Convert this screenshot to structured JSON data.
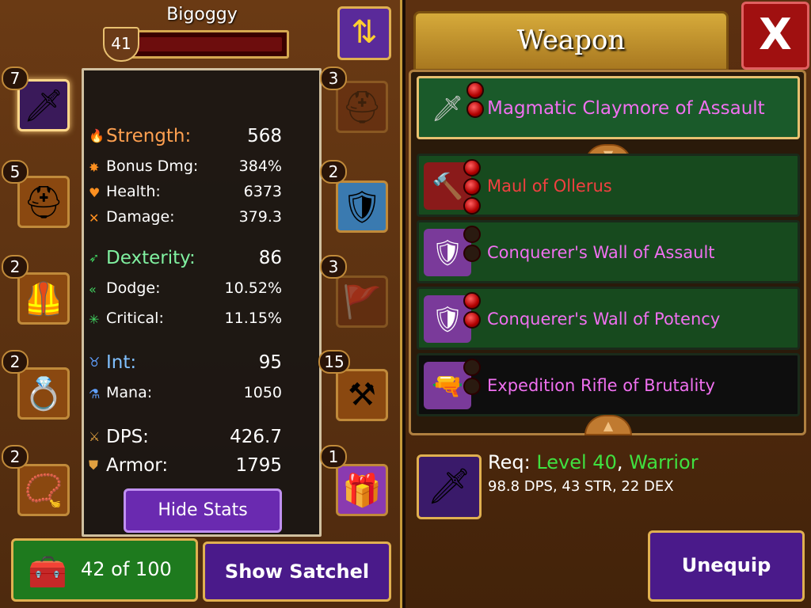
{
  "hero": {
    "name": "Bigoggy",
    "level": "41"
  },
  "left_slots": [
    {
      "count": "7",
      "icon": "dagger-icon"
    },
    {
      "count": "5",
      "icon": "helmet-icon"
    },
    {
      "count": "2",
      "icon": "chest-armor-icon"
    },
    {
      "count": "2",
      "icon": "ring-icon"
    },
    {
      "count": "2",
      "icon": "amulet-icon"
    }
  ],
  "right_slots": [
    {
      "count": "3",
      "icon": "helmet-icon"
    },
    {
      "count": "2",
      "icon": "shoulder-armor-icon"
    },
    {
      "count": "3",
      "icon": "banner-icon"
    },
    {
      "count": "15",
      "icon": "anvil-icon"
    },
    {
      "count": "1",
      "icon": "treasure-chest-icon"
    }
  ],
  "stats": {
    "strength": {
      "label": "Strength:",
      "value": "568"
    },
    "bonus_dmg": {
      "label": "Bonus Dmg:",
      "value": "384%"
    },
    "health": {
      "label": "Health:",
      "value": "6373"
    },
    "damage": {
      "label": "Damage:",
      "value": "379.3"
    },
    "dexterity": {
      "label": "Dexterity:",
      "value": "86"
    },
    "dodge": {
      "label": "Dodge:",
      "value": "10.52%"
    },
    "critical": {
      "label": "Critical:",
      "value": "11.15%"
    },
    "int": {
      "label": "Int:",
      "value": "95"
    },
    "mana": {
      "label": "Mana:",
      "value": "1050"
    },
    "dps": {
      "label": "DPS:",
      "value": "426.7"
    },
    "armor": {
      "label": "Armor:",
      "value": "1795"
    }
  },
  "buttons": {
    "hide_stats": "Hide Stats",
    "bag_count": "42 of 100",
    "show_satchel": "Show Satchel",
    "unequip": "Unequip",
    "close": "X"
  },
  "weapon_tab": {
    "title": "Weapon"
  },
  "equipped": {
    "name": "Magmatic Claymore of Assault"
  },
  "items": [
    {
      "name": "Maul of Ollerus",
      "color": "#f04040"
    },
    {
      "name": "Conquerer's Wall of Assault",
      "color": "#f070f0"
    },
    {
      "name": "Conquerer's Wall of Potency",
      "color": "#f070f0"
    },
    {
      "name": "Expedition Rifle of Brutality",
      "color": "#f070f0"
    }
  ],
  "requirements": {
    "prefix": "Req:",
    "level": "Level 40",
    "sep": ",",
    "class": "Warrior",
    "summary": "98.8 DPS, 43 STR, 22 DEX"
  },
  "colors": {
    "accent_gold": "#e0b050",
    "item_green": "#40e040",
    "rare_pink": "#f070f0",
    "legendary_red": "#f04040"
  }
}
